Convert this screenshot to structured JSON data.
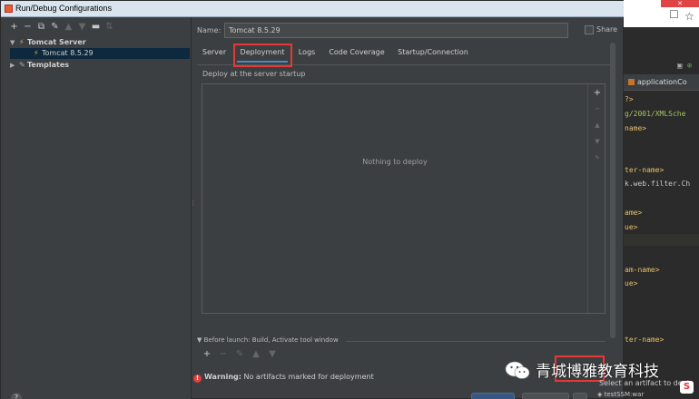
{
  "window": {
    "title": "Run/Debug Configurations"
  },
  "tree": {
    "toolbar_icons": [
      "add-icon",
      "remove-icon",
      "copy-icon",
      "wrench-icon",
      "move-up-icon",
      "move-down-icon",
      "folder-icon",
      "sort-icon"
    ],
    "items": [
      {
        "label": "Tomcat Server",
        "expanded": true,
        "level": 0
      },
      {
        "label": "Tomcat 8.5.29",
        "selected": true,
        "level": 1
      },
      {
        "label": "Templates",
        "expanded": false,
        "level": 0
      }
    ]
  },
  "config": {
    "name_label": "Name:",
    "name_value": "Tomcat 8.5.29",
    "share_label": "Share",
    "share_checked": false,
    "tabs": [
      {
        "label": "Server"
      },
      {
        "label": "Deployment",
        "active": true
      },
      {
        "label": "Logs"
      },
      {
        "label": "Code Coverage"
      },
      {
        "label": "Startup/Connection"
      }
    ],
    "deploy_caption": "Deploy at the server startup",
    "empty_text": "Nothing to deploy",
    "before_launch": "Before launch: Build, Activate tool window",
    "warning_label": "Warning:",
    "warning_text": "No artifacts marked for deployment"
  },
  "background": {
    "editor_tab": "applicationCo",
    "code_lines": [
      "?>",
      "g/2001/XMLSche",
      "name>",
      "ter-name>",
      "k.web.filter.Ch",
      "ame>",
      "ue>",
      "am-name>",
      "ue>",
      "ter-name>"
    ],
    "tooltip": "Select an artifact to depl",
    "artifact_item": "testSSM:war"
  },
  "watermark": {
    "text": "青城博雅教育科技"
  },
  "colors": {
    "accent_tab": "#4a88c7",
    "highlight_box": "#e53935",
    "warning": "#e04040"
  }
}
